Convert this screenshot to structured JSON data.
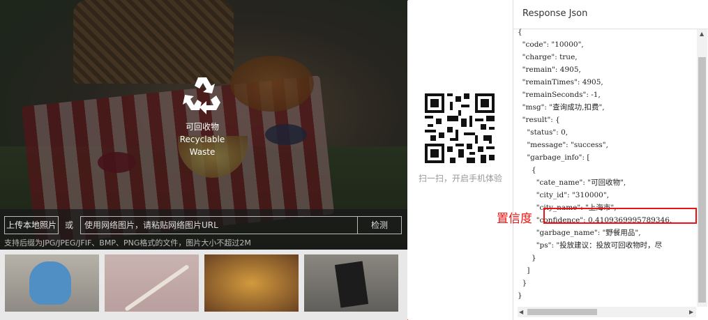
{
  "demo": {
    "result": {
      "cate_cn": "可回收物",
      "cate_en": "Recyclable Waste"
    },
    "upload": {
      "local_button": "上传本地照片",
      "or": "或",
      "url_placeholder": "使用网络图片，请粘贴网络图片URL",
      "detect_button": "检测",
      "hint": "支持后缀为JPG/JPEG/JFIF、BMP、PNG格式的文件，图片大小不超过2M"
    },
    "thumbnails": [
      "toy elephant",
      "thermometer",
      "food dish",
      "book"
    ]
  },
  "qr": {
    "caption": "扫一扫，开启手机体验"
  },
  "response": {
    "title": "Response Json",
    "lines": [
      "{",
      "  \"code\": \"10000\",",
      "  \"charge\": true,",
      "  \"remain\": 4905,",
      "  \"remainTimes\": 4905,",
      "  \"remainSeconds\": -1,",
      "  \"msg\": \"查询成功,扣费\",",
      "  \"result\": {",
      "    \"status\": 0,",
      "    \"message\": \"success\",",
      "    \"garbage_info\": [",
      "      {",
      "        \"cate_name\": \"可回收物\",",
      "        \"city_id\": \"310000\",",
      "        \"city_name\": \"上海市\",",
      "        \"confidence\": 0.4109369995789346,",
      "        \"garbage_name\": \"野餐用品\",",
      "        \"ps\": \"投放建议：投放可回收物时，尽",
      "      }",
      "    ]",
      "  }",
      "}"
    ]
  },
  "annotation": {
    "label": "置信度",
    "color": "#e11111"
  }
}
